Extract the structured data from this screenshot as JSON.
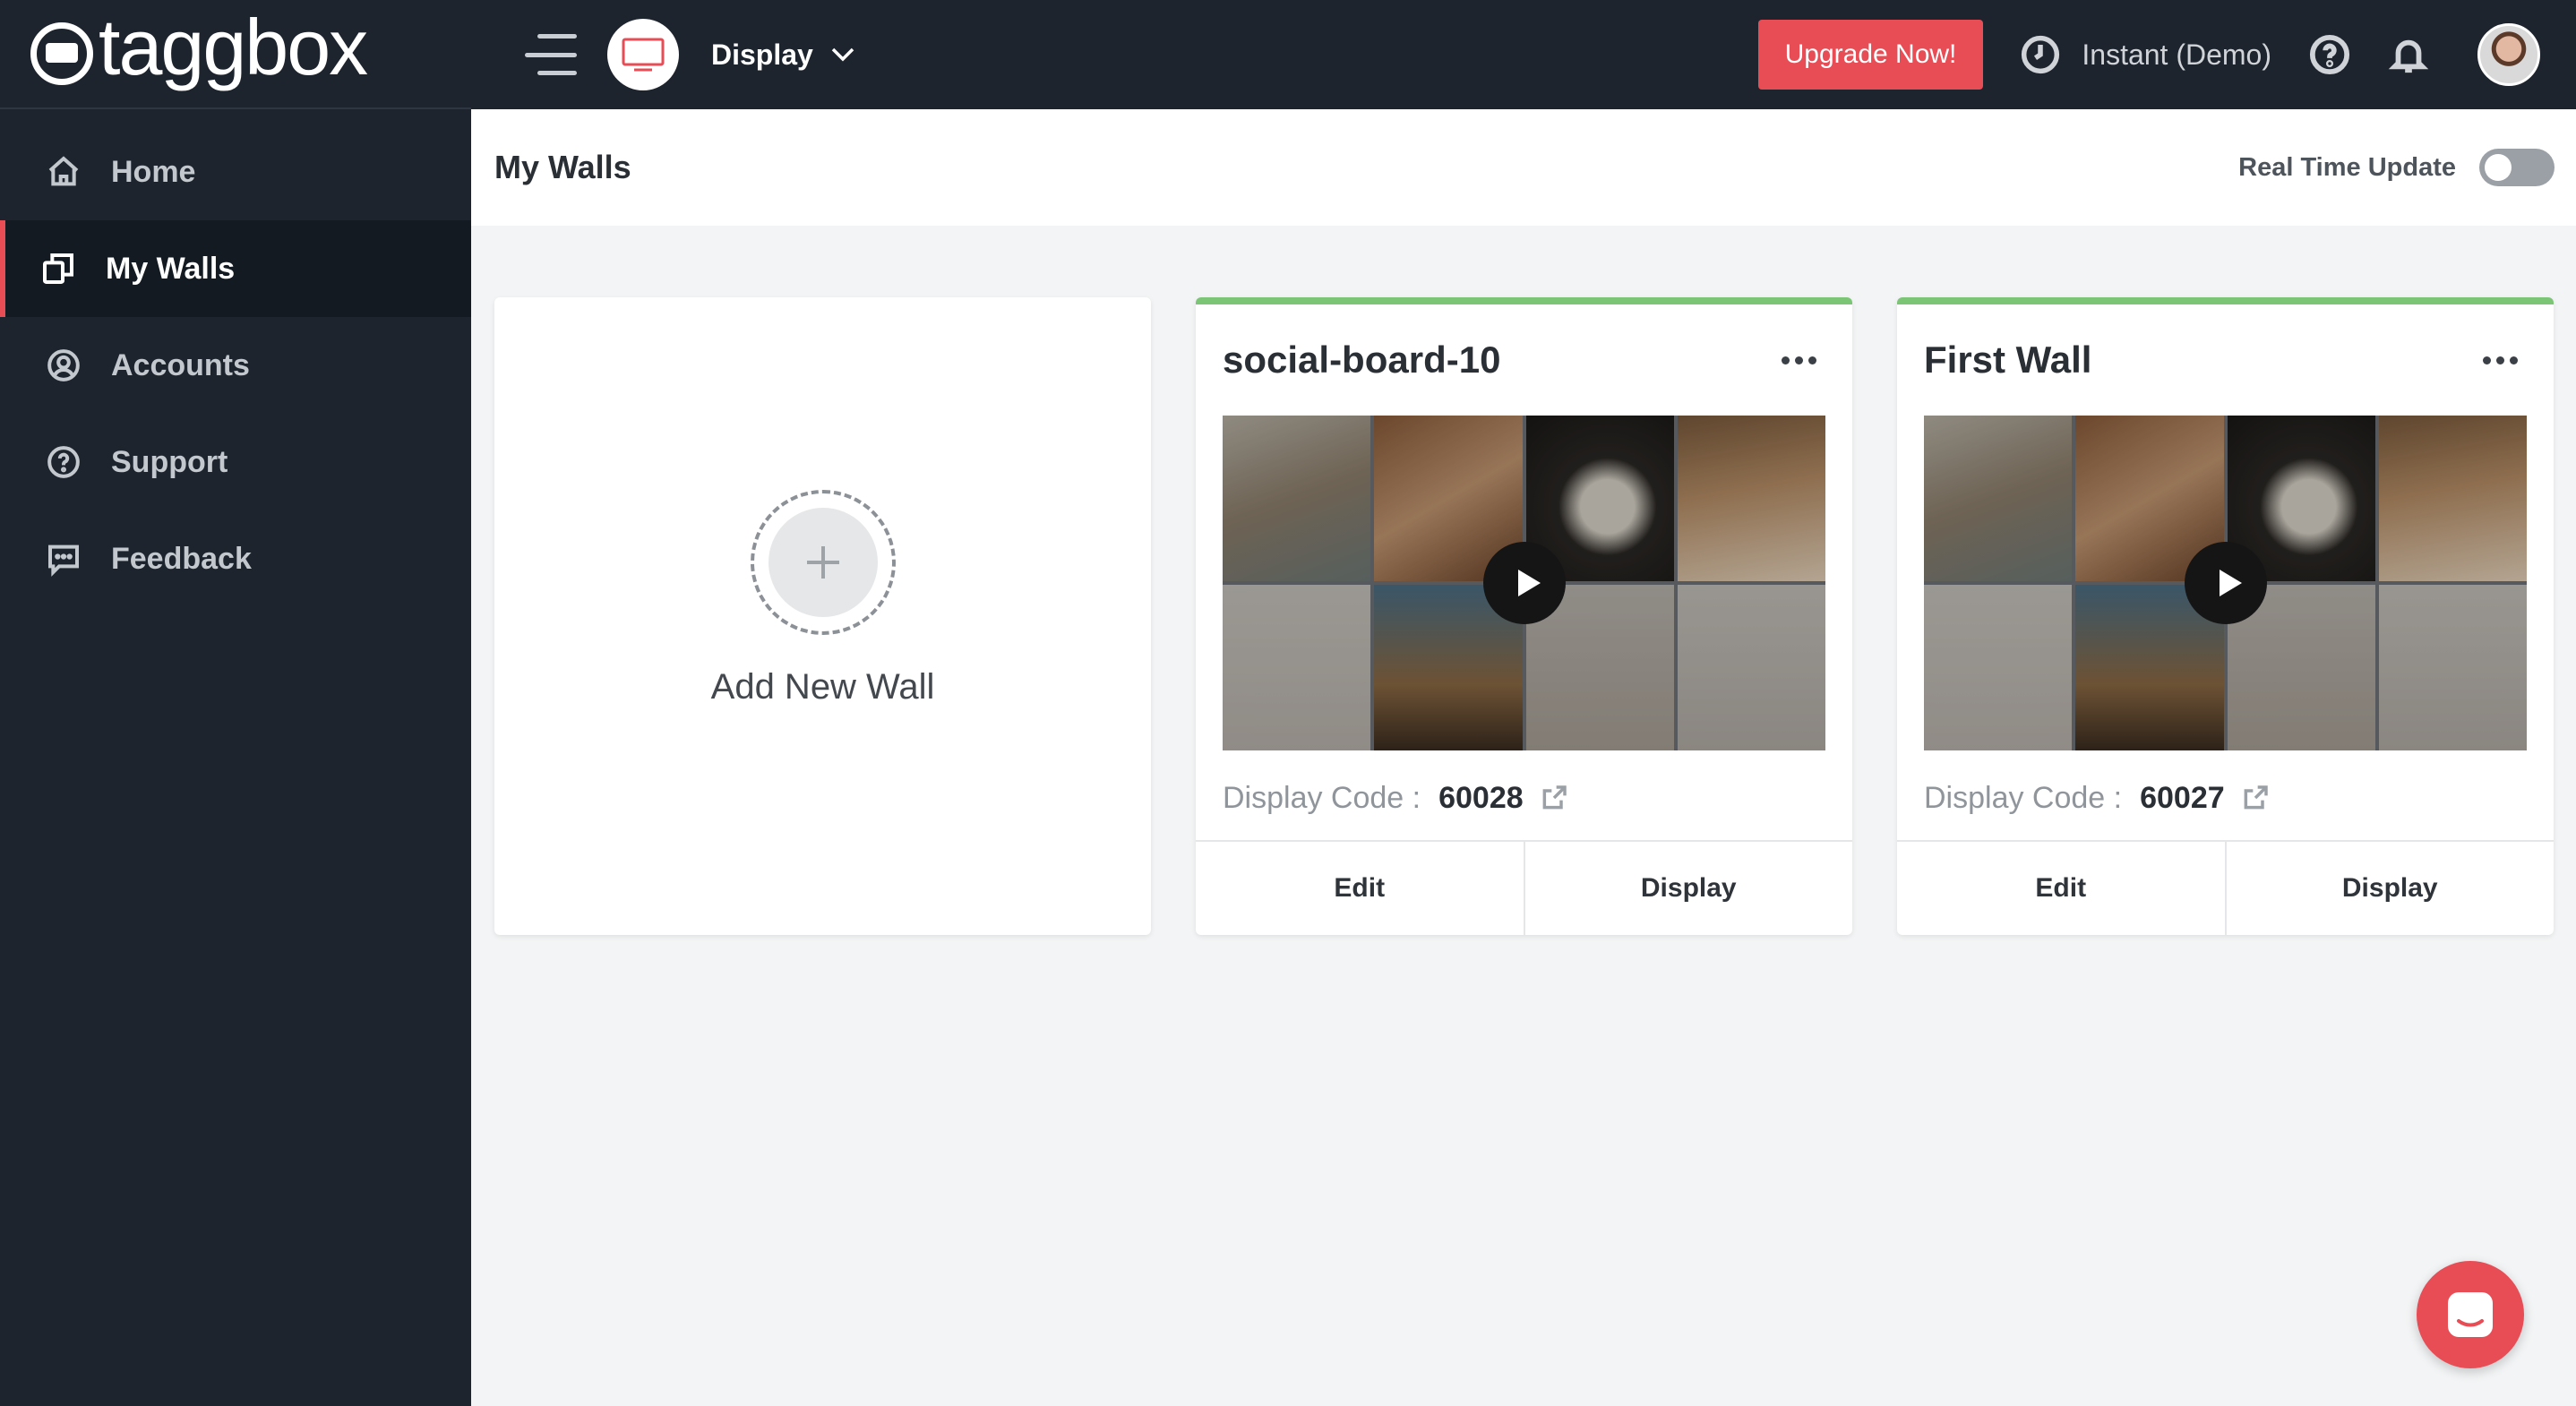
{
  "brand": {
    "name": "taggbox"
  },
  "sidebar": {
    "items": [
      {
        "label": "Home",
        "icon": "home-icon",
        "active": false
      },
      {
        "label": "My Walls",
        "icon": "walls-icon",
        "active": true
      },
      {
        "label": "Accounts",
        "icon": "user-circle-icon",
        "active": false
      },
      {
        "label": "Support",
        "icon": "help-circle-icon",
        "active": false
      },
      {
        "label": "Feedback",
        "icon": "chat-bubble-icon",
        "active": false
      }
    ]
  },
  "topbar": {
    "product_select": "Display",
    "upgrade_label": "Upgrade Now!",
    "plan_label": "Instant (Demo)"
  },
  "page": {
    "title": "My Walls",
    "realtime_label": "Real Time Update",
    "realtime_enabled": false
  },
  "add_wall": {
    "label": "Add New Wall"
  },
  "walls": [
    {
      "title": "social-board-10",
      "code_label": "Display Code :",
      "code": "60028",
      "edit_label": "Edit",
      "display_label": "Display"
    },
    {
      "title": "First Wall",
      "code_label": "Display Code :",
      "code": "60027",
      "edit_label": "Edit",
      "display_label": "Display"
    }
  ],
  "colors": {
    "accent": "#e84c55",
    "dark": "#1d242d",
    "wall_status": "#7cc576"
  }
}
